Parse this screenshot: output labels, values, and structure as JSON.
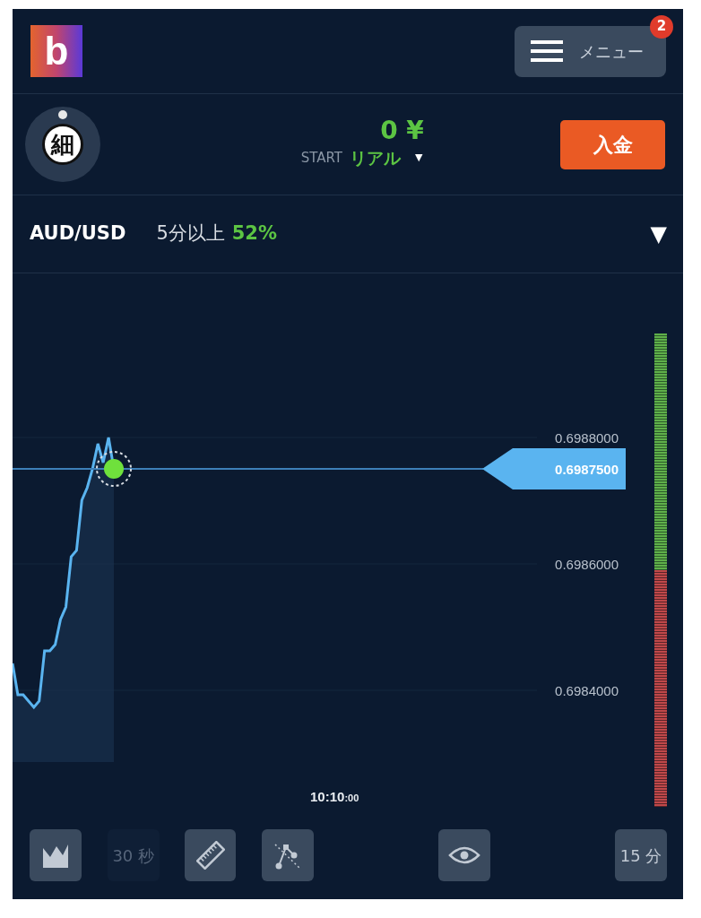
{
  "header": {
    "logo": "b",
    "menu_button": {
      "label": "メニュー",
      "badge": "2"
    }
  },
  "account": {
    "avatar": "細",
    "balance": "0 ¥",
    "mode_prefix": "START",
    "mode": "リアル",
    "mode_caret": "▼",
    "deposit_button": "入金"
  },
  "asset": {
    "pair": "AUD/USD",
    "condition": "5分以上",
    "payout": "52%",
    "caret": "▼"
  },
  "chart": {
    "current_price": "0.6987500",
    "time_label": {
      "main": "10:10",
      "seconds": ":00"
    },
    "price_labels": [
      "0.6988000",
      "0.6986000",
      "0.6984000"
    ]
  },
  "sentiment_bar": {
    "level": 0.5
  },
  "toolbar": [
    {
      "kind": "area",
      "disabled": false
    },
    {
      "kind": "text",
      "label": "30 秒",
      "disabled": true
    },
    {
      "kind": "ruler",
      "disabled": false
    },
    {
      "kind": "lines",
      "disabled": false
    },
    {
      "kind": "eye",
      "disabled": false
    },
    {
      "kind": "text",
      "label": "15 分",
      "disabled": false
    }
  ]
}
